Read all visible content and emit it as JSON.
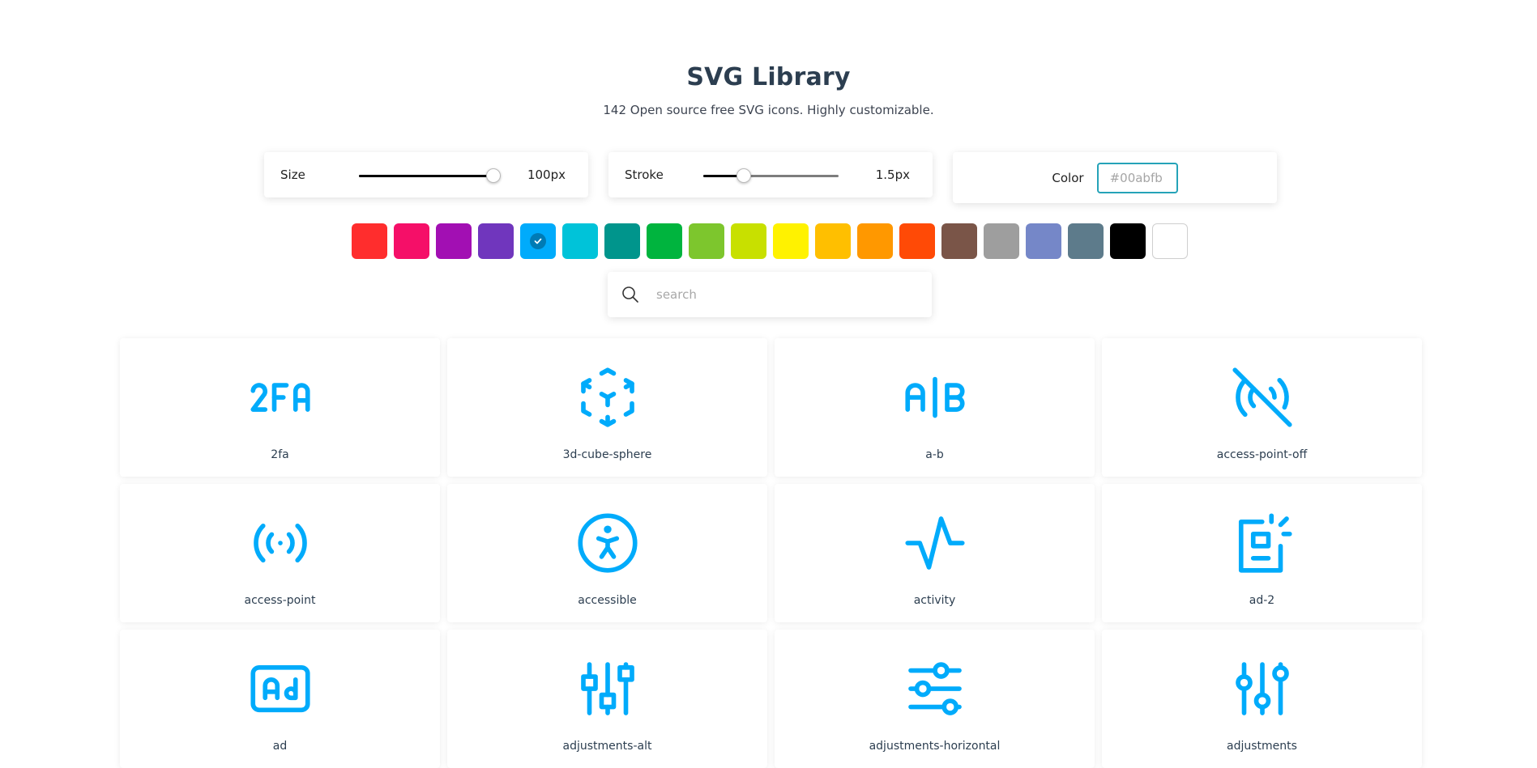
{
  "header": {
    "title": "SVG Library",
    "subtitle": "142 Open source free SVG icons. Highly customizable."
  },
  "controls": {
    "size": {
      "label": "Size",
      "value_label": "100px",
      "level": 0.95
    },
    "stroke": {
      "label": "Stroke",
      "value_label": "1.5px",
      "level": 0.3
    },
    "color": {
      "label": "Color",
      "placeholder": "#00abfb"
    }
  },
  "accent_color": "#00abfb",
  "swatches": [
    {
      "color": "#ff2d2d",
      "name": "red"
    },
    {
      "color": "#f50f68",
      "name": "pink"
    },
    {
      "color": "#a20fb3",
      "name": "purple"
    },
    {
      "color": "#7036bd",
      "name": "deep-purple"
    },
    {
      "color": "#00abfb",
      "name": "light-blue",
      "selected": true
    },
    {
      "color": "#00c3d9",
      "name": "cyan"
    },
    {
      "color": "#00958c",
      "name": "teal"
    },
    {
      "color": "#00b43e",
      "name": "green"
    },
    {
      "color": "#7dc62d",
      "name": "light-green"
    },
    {
      "color": "#c8e000",
      "name": "lime"
    },
    {
      "color": "#fff200",
      "name": "yellow"
    },
    {
      "color": "#ffbf00",
      "name": "amber"
    },
    {
      "color": "#ff9800",
      "name": "orange"
    },
    {
      "color": "#ff4a06",
      "name": "deep-orange"
    },
    {
      "color": "#7a5548",
      "name": "brown"
    },
    {
      "color": "#9e9e9e",
      "name": "grey"
    },
    {
      "color": "#7587c8",
      "name": "indigo-light"
    },
    {
      "color": "#5d7b8b",
      "name": "blue-grey"
    },
    {
      "color": "#000000",
      "name": "black"
    },
    {
      "color": "#ffffff",
      "name": "white"
    }
  ],
  "search": {
    "placeholder": "search"
  },
  "icons": [
    {
      "name": "2fa"
    },
    {
      "name": "3d-cube-sphere"
    },
    {
      "name": "a-b"
    },
    {
      "name": "access-point-off"
    },
    {
      "name": "access-point"
    },
    {
      "name": "accessible"
    },
    {
      "name": "activity"
    },
    {
      "name": "ad-2"
    },
    {
      "name": "ad"
    },
    {
      "name": "adjustments-alt"
    },
    {
      "name": "adjustments-horizontal"
    },
    {
      "name": "adjustments"
    }
  ]
}
